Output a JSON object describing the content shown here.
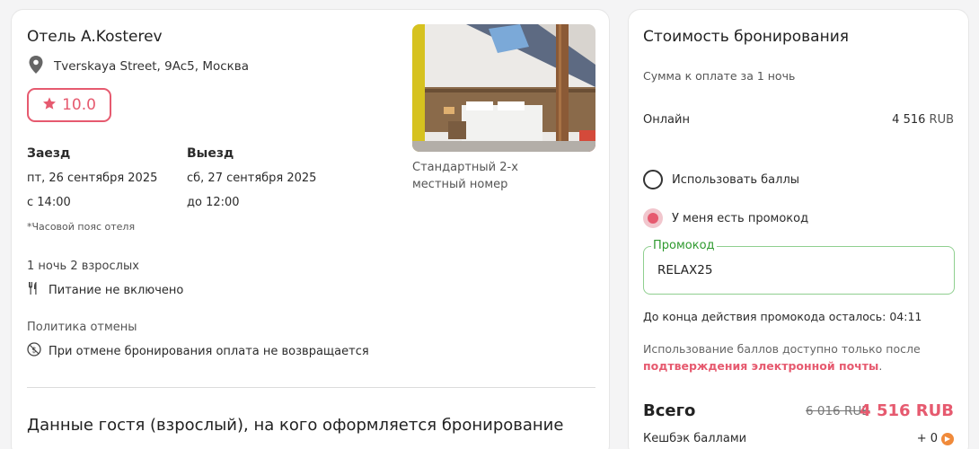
{
  "hotel": {
    "name": "Отель A.Kosterev",
    "address": "Tverskaya Street, 9Ac5, Москва",
    "rating": "10.0",
    "icons": {
      "location": "location-pin-icon",
      "rating": "star-icon"
    }
  },
  "checkin": {
    "label": "Заезд",
    "date": "пт, 26 сентября 2025",
    "time": "с 14:00"
  },
  "checkout": {
    "label": "Выезд",
    "date": "сб, 27 сентября 2025",
    "time": "до 12:00"
  },
  "timezone_note": "*Часовой пояс отеля",
  "guests": "1 ночь  2 взрослых",
  "meal": {
    "text": "Питание не включено",
    "icon": "fork-knife-icon"
  },
  "policy": {
    "title": "Политика отмены",
    "text": "При отмене бронирования оплата не возвращается",
    "icon": "no-refund-icon"
  },
  "room": {
    "name": "Стандартный 2-х местный номер"
  },
  "guest_section_title": "Данные гостя (взрослый), на кого оформляется бронирование",
  "pricing": {
    "title": "Стоимость бронирования",
    "subtitle": "Сумма к оплате за 1 ночь",
    "online_label": "Онлайн",
    "online_amount": "4 516",
    "online_currency": "RUB",
    "use_points_label": "Использовать баллы",
    "have_promo_label": "У меня есть промокод",
    "promo_legend": "Промокод",
    "promo_value": "RELAX25",
    "timer_text": "До конца действия промокода осталось: 04:11",
    "note_text": "Использование баллов доступно только после ",
    "note_link": "подтверждения электронной почты",
    "note_end": ".",
    "total_label": "Всего",
    "total_old": "6 016 RUB",
    "total_new": "4 516 RUB",
    "cashback_label": "Кешбэк баллами",
    "cashback_value": "+ 0"
  },
  "colors": {
    "accent": "#e65a6f",
    "promo_green": "#2f9a2f"
  }
}
